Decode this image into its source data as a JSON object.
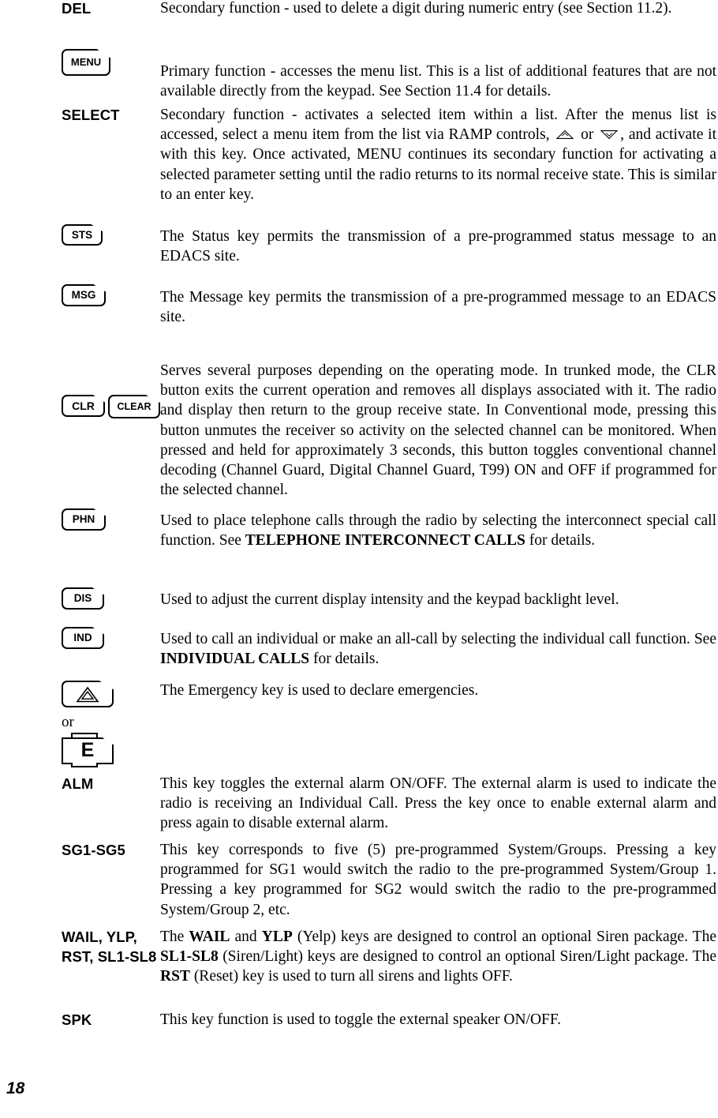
{
  "page": {
    "number": "18"
  },
  "entries": [
    {
      "id": "del",
      "label_type": "text",
      "label": "DEL",
      "text": "Secondary function - used to delete a digit during numeric entry (see Section 11.2)."
    },
    {
      "id": "menu",
      "label_type": "keycap",
      "keycap": "MENU",
      "text": "Primary function - accesses the menu list.  This is a list of additional features that are not available directly from the keypad.  See Section 11.4 for details."
    },
    {
      "id": "select",
      "label_type": "text",
      "label": "SELECT",
      "text_part_1": "Secondary function - activates a selected item within a list.  After the menus list is accessed, select a menu item from the list via RAMP controls, ",
      "ramp_up_icon": "ramp-up-arrow-icon",
      "text_part_2": " or ",
      "ramp_down_icon": "ramp-down-arrow-icon",
      "text_part_3": ", and activate it with this key.  Once activated, MENU continues its secondary function for activating a selected parameter setting until the radio returns to its normal receive state.  This is similar to an enter key."
    },
    {
      "id": "sts",
      "label_type": "keycap",
      "keycap": "STS",
      "text": "The Status key permits the transmission of a pre-programmed status message to an EDACS site."
    },
    {
      "id": "msg",
      "label_type": "keycap",
      "keycap": "MSG",
      "text": "The Message key permits the transmission of a pre-programmed message to an EDACS site."
    },
    {
      "id": "clr",
      "label_type": "keycap-pair",
      "keycap_1": "CLR",
      "keycap_2": "CLEAR",
      "text": "Serves several purposes depending on the operating mode.  In trunked mode, the CLR button exits the current operation and removes all displays associated with it.  The radio and display then return to the group receive state.  In Conventional mode, pressing this button unmutes the receiver so activity on the selected channel can be monitored.  When pressed and held for approximately 3 seconds, this button toggles conventional channel decoding (Channel Guard, Digital Channel Guard, T99) ON and OFF if programmed for the selected channel."
    },
    {
      "id": "phn",
      "label_type": "keycap",
      "keycap": "PHN",
      "text_part_1": "Used to place telephone calls through the radio by selecting the interconnect special call function.  See ",
      "bold_term": "TELEPHONE INTERCONNECT CALLS",
      "text_part_2": " for details."
    },
    {
      "id": "dis",
      "label_type": "keycap",
      "keycap": "DIS",
      "text": "Used to adjust the current display intensity and the keypad backlight level."
    },
    {
      "id": "ind",
      "label_type": "keycap",
      "keycap": "IND",
      "text_part_1": "Used to call an individual or make an all-call by selecting the individual call function.  See ",
      "bold_term": "INDIVIDUAL CALLS",
      "text_part_2": " for details."
    },
    {
      "id": "emergency",
      "label_type": "keycap-emergency",
      "keycap_1_icon": "warning-triangle-icon",
      "or_label": "or",
      "keycap_2": "E",
      "text": "The Emergency key is used to declare emergencies."
    },
    {
      "id": "alm",
      "label_type": "text",
      "label": "ALM",
      "text": "This key toggles the external alarm ON/OFF.  The external alarm is used to indicate the radio is receiving an Individual Call.  Press the key once to enable external alarm and press again to disable external alarm."
    },
    {
      "id": "sg1-sg5",
      "label_type": "text",
      "label": "SG1-SG5",
      "text": "This key corresponds to five (5) pre-programmed System/Groups.  Pressing a key programmed for SG1 would switch the radio to the pre-programmed System/Group 1.  Pressing a key programmed for SG2 would switch the radio to the pre-programmed System/Group 2, etc."
    },
    {
      "id": "wail",
      "label_type": "text",
      "label": "WAIL, YLP, RST, SL1-SL8",
      "text_a1": "The ",
      "text_b1": "WAIL",
      "text_a2": " and ",
      "text_b2": "YLP",
      "text_a3": " (Yelp) keys are designed to control an optional Siren package.  The ",
      "text_b3": "SL1-SL8",
      "text_a4": " (Siren/Light) keys are designed to control an optional Siren/Light package.  The ",
      "text_b4": "RST",
      "text_a5": " (Reset) key is used to turn all sirens and lights OFF."
    },
    {
      "id": "spk",
      "label_type": "text",
      "label": "SPK",
      "text": "This key function is used to toggle the external speaker ON/OFF."
    }
  ]
}
